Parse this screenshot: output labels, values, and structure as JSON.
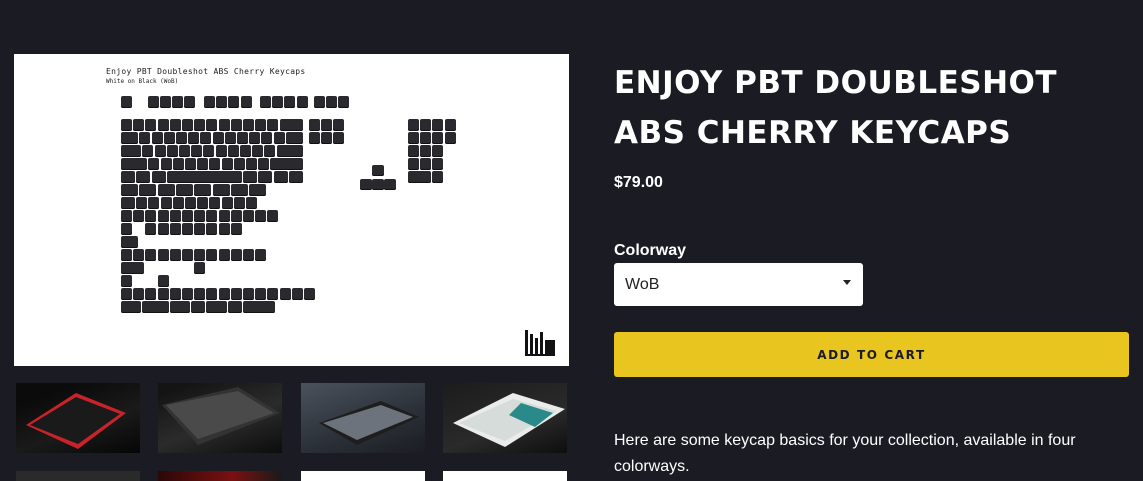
{
  "product": {
    "title": "ENJOY PBT DOUBLESHOT ABS CHERRY KEYCAPS",
    "price": "$79.00",
    "option_label": "Colorway",
    "selected_option": "WoB",
    "add_to_cart_label": "ADD TO CART",
    "description": "Here are some keycap basics for your collection, available in four colorways."
  },
  "main_image": {
    "title": "Enjoy PBT Doubleshot ABS Cherry Keycaps",
    "subtitle": "White on Black (WoB)"
  },
  "thumbnails": [
    {
      "name": "thumb-1",
      "accent": "#c8232a"
    },
    {
      "name": "thumb-2",
      "accent": "#8c8c8c"
    },
    {
      "name": "thumb-3",
      "accent": "#9aa2ab"
    },
    {
      "name": "thumb-4",
      "accent": "#2a8a8a"
    },
    {
      "name": "thumb-5",
      "accent": "#555555"
    },
    {
      "name": "thumb-6",
      "accent": "#c8232a"
    },
    {
      "name": "thumb-7",
      "accent": "#ffffff"
    },
    {
      "name": "thumb-8",
      "accent": "#ffffff"
    }
  ],
  "colors": {
    "background": "#1b1b24",
    "accent_button": "#e8c51f",
    "text": "#ffffff"
  }
}
